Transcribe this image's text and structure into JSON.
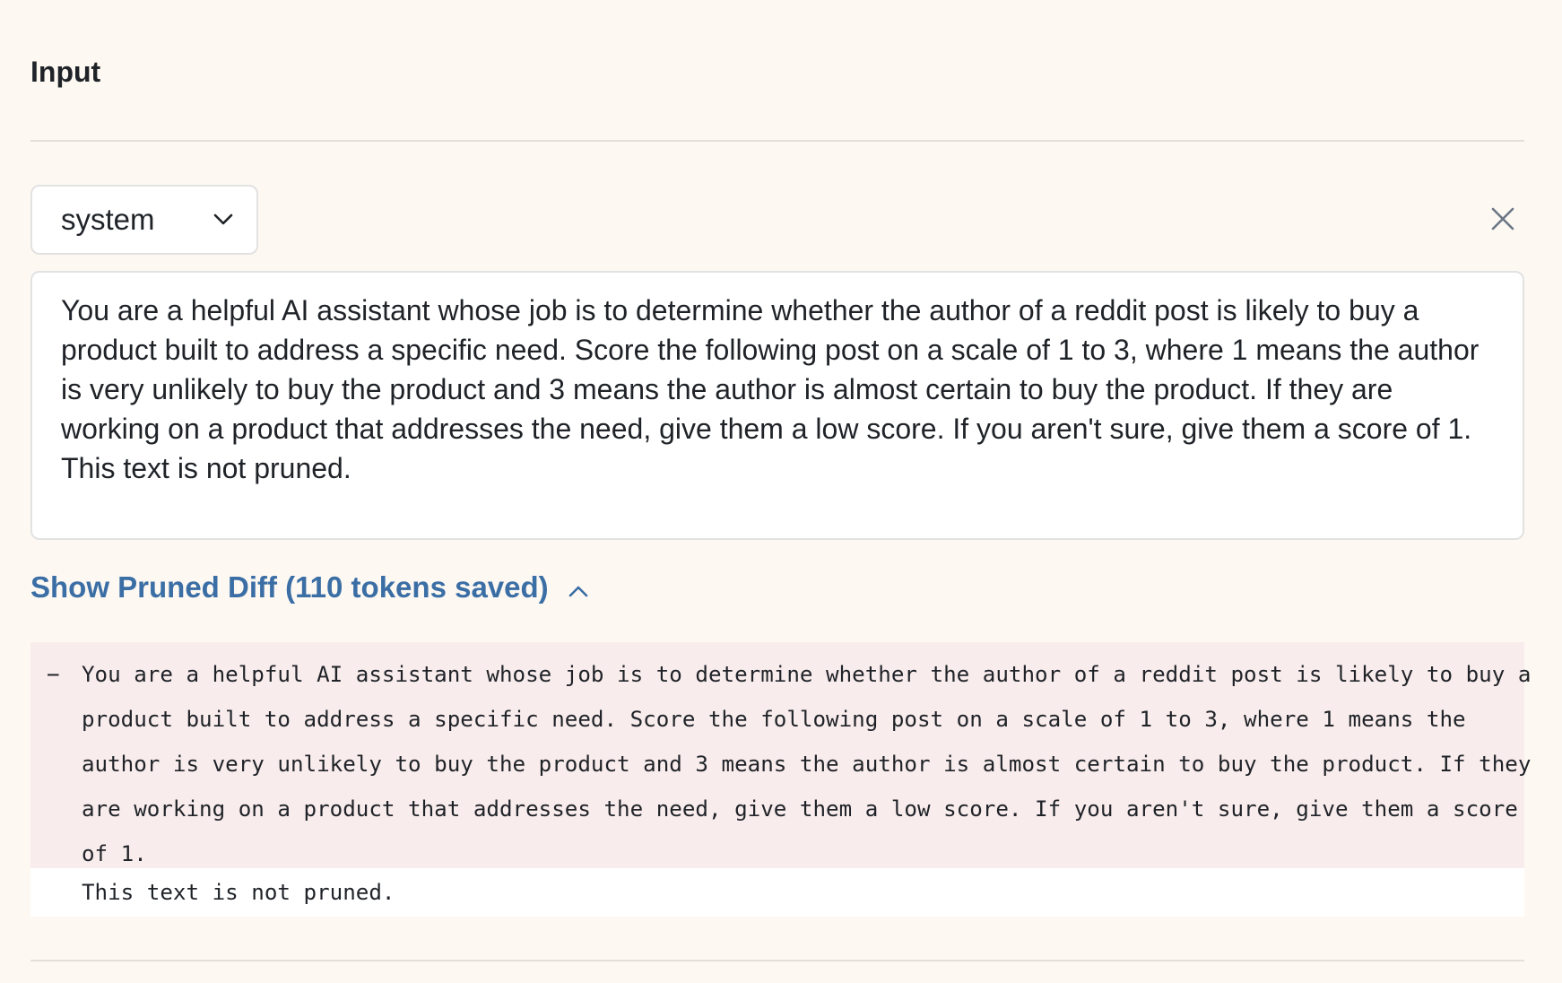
{
  "section": {
    "title": "Input"
  },
  "message": {
    "role": "system",
    "text": "You are a helpful AI assistant whose job is to determine whether the author of a reddit post is likely to buy a product built to address a specific need. Score the following post on a scale of 1 to 3, where 1 means the author is very unlikely to buy the product and 3 means the author is almost certain to buy the product. If they are working on a product that addresses the need, give them a low score. If you aren't sure, give them a score of 1.",
    "text_unpruned": "This text is not pruned."
  },
  "diff_toggle": {
    "label": "Show Pruned Diff (110 tokens saved)"
  },
  "diff": {
    "removed_marker": "−",
    "removed_lines": [
      "You are a helpful AI assistant whose job is to determine whether the author of a reddit post is likely to buy a",
      "product built to address a specific need. Score the following post on a scale of 1 to 3, where 1 means the",
      "author is very unlikely to buy the product and 3 means the author is almost certain to buy the product. If they",
      "are working on a product that addresses the need, give them a low score. If you aren't sure, give them a score",
      "of 1."
    ],
    "unchanged_line": "This text is not pruned."
  },
  "icons": {
    "dropdown": "chevron-down-icon",
    "close": "close-icon",
    "toggle": "chevron-up-icon"
  },
  "colors": {
    "background": "#fdf8f2",
    "link": "#3a6ea5",
    "removed_bg": "#f9ecec"
  }
}
